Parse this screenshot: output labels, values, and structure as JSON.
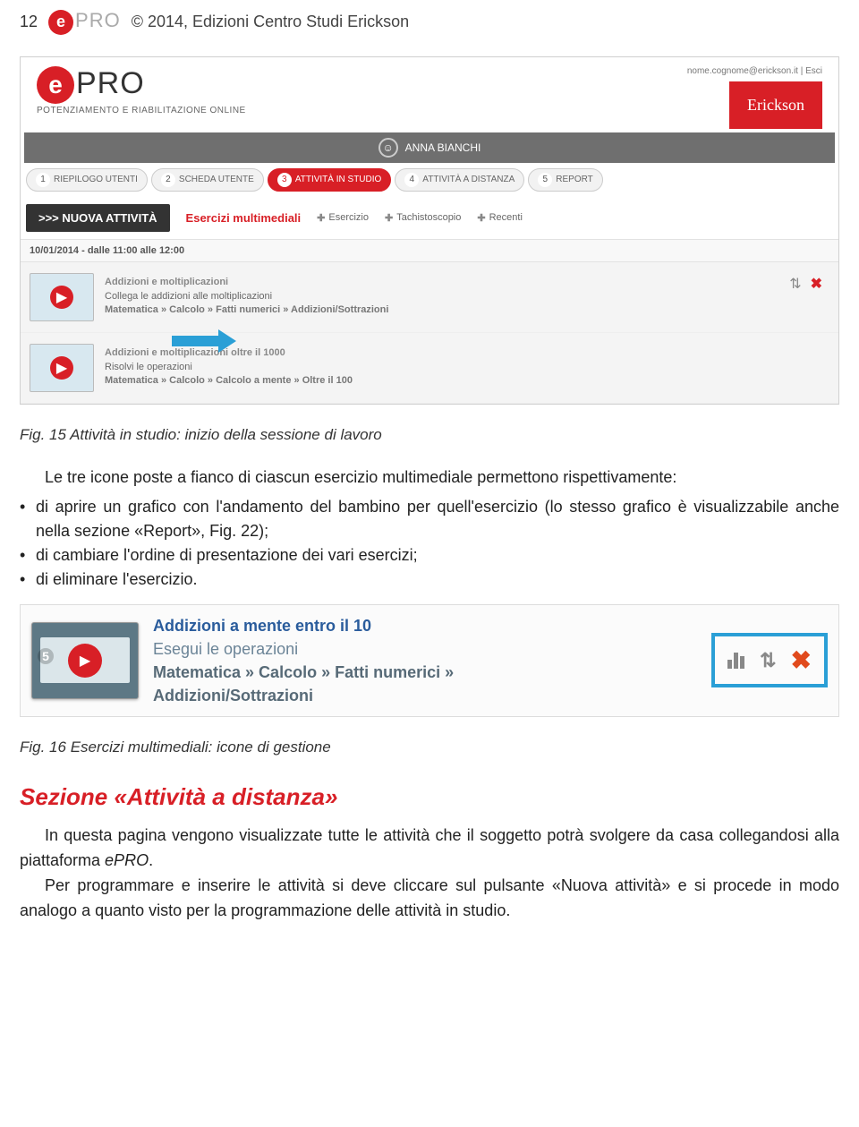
{
  "doc": {
    "page_number": "12",
    "copyright": "© 2014, Edizioni Centro Studi Erickson"
  },
  "logo": {
    "e": "e",
    "pro": "PRO"
  },
  "screenshot1": {
    "email_line": "nome.cognome@erickson.it  |  Esci",
    "erickson": "Erickson",
    "subtitle": "POTENZIAMENTO E RIABILITAZIONE ONLINE",
    "user": "ANNA BIANCHI",
    "tabs": [
      {
        "n": "1",
        "label": "RIEPILOGO UTENTI"
      },
      {
        "n": "2",
        "label": "SCHEDA UTENTE"
      },
      {
        "n": "3",
        "label": "ATTIVITÀ IN STUDIO"
      },
      {
        "n": "4",
        "label": "ATTIVITÀ A DISTANZA"
      },
      {
        "n": "5",
        "label": "REPORT"
      }
    ],
    "nuova_btn": ">>> NUOVA ATTIVITÀ",
    "ex_header": "Esercizi multimediali",
    "opt1": "Esercizio",
    "opt2": "Tachistoscopio",
    "opt3": "Recenti",
    "date_line": "10/01/2014 - dalle 11:00 alle 12:00",
    "item1": {
      "title": "Addizioni e moltiplicazioni",
      "desc": "Collega le addizioni alle moltiplicazioni",
      "path": "Matematica » Calcolo » Fatti numerici » Addizioni/Sottrazioni"
    },
    "item2": {
      "title": "Addizioni e moltiplicazioni oltre il 1000",
      "desc": "Risolvi le operazioni",
      "path": "Matematica » Calcolo » Calcolo a mente » Oltre il 100"
    }
  },
  "caption1": "Fig. 15  Attività in studio: inizio della sessione di lavoro",
  "body": {
    "intro": "Le tre icone poste a fianco di ciascun esercizio multimediale permettono rispettivamente:",
    "bullet1": "di aprire un grafico con l'andamento del bambino per quell'esercizio (lo stesso grafico è visualizzabile anche nella sezione «Report», Fig. 22);",
    "bullet2": "di cambiare l'ordine di presentazione dei vari esercizi;",
    "bullet3": "di eliminare l'esercizio."
  },
  "screenshot2": {
    "num": "5",
    "t1": "Addizioni a mente entro il 10",
    "t2": "Esegui le operazioni",
    "t3a": "Matematica » Calcolo » Fatti numerici »",
    "t3b": "Addizioni/Sottrazioni"
  },
  "caption2": "Fig. 16  Esercizi multimediali: icone di gestione",
  "section_heading": "Sezione «Attività a distanza»",
  "para1_a": "In questa pagina vengono visualizzate tutte le attività che il soggetto potrà svolgere da casa collegandosi alla piattaforma ",
  "para1_brand": "ePRO",
  "para1_b": ".",
  "para2": "Per programmare e inserire le attività si deve cliccare sul pulsante «Nuova attività» e si procede in modo analogo a quanto visto per la programmazione delle attività in studio."
}
